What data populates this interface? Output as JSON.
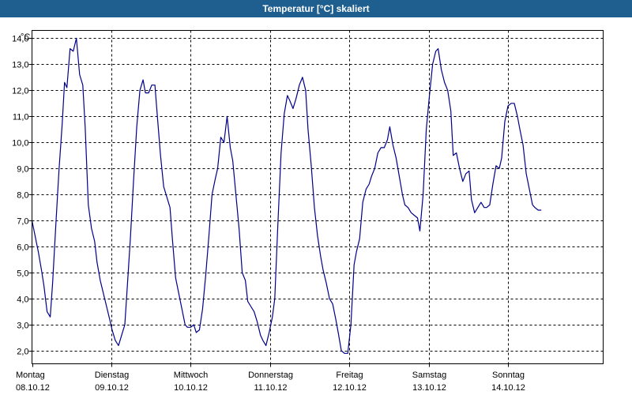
{
  "window": {
    "title": "Temperatur [°C] skaliert"
  },
  "chart_data": {
    "type": "line",
    "title": "Temperatur [°C] skaliert",
    "ylabel": "°C",
    "xlabel": "",
    "ylim": [
      1.5,
      14.3
    ],
    "xlim": [
      0,
      7.2
    ],
    "grid": true,
    "yticks": [
      "2,0",
      "3,0",
      "4,0",
      "5,0",
      "6,0",
      "7,0",
      "8,0",
      "9,0",
      "10,0",
      "11,0",
      "12,0",
      "13,0",
      "14,0"
    ],
    "ytick_values": [
      2,
      3,
      4,
      5,
      6,
      7,
      8,
      9,
      10,
      11,
      12,
      13,
      14
    ],
    "days": [
      {
        "day": "Montag",
        "date": "08.10.12"
      },
      {
        "day": "Dienstag",
        "date": "09.10.12"
      },
      {
        "day": "Mittwoch",
        "date": "10.10.12"
      },
      {
        "day": "Donnerstag",
        "date": "11.10.12"
      },
      {
        "day": "Freitag",
        "date": "12.10.12"
      },
      {
        "day": "Samstag",
        "date": "13.10.12"
      },
      {
        "day": "Sonntag",
        "date": "14.10.12"
      }
    ],
    "line_color": "#00008b",
    "series": [
      {
        "points": [
          [
            0.0,
            7.0
          ],
          [
            0.04,
            6.4
          ],
          [
            0.08,
            5.8
          ],
          [
            0.12,
            5.1
          ],
          [
            0.15,
            4.5
          ],
          [
            0.19,
            3.5
          ],
          [
            0.23,
            3.3
          ],
          [
            0.26,
            4.6
          ],
          [
            0.3,
            6.8
          ],
          [
            0.34,
            8.9
          ],
          [
            0.38,
            10.7
          ],
          [
            0.41,
            12.3
          ],
          [
            0.44,
            12.1
          ],
          [
            0.48,
            13.6
          ],
          [
            0.52,
            13.5
          ],
          [
            0.56,
            14.0
          ],
          [
            0.6,
            12.6
          ],
          [
            0.64,
            12.2
          ],
          [
            0.67,
            10.6
          ],
          [
            0.71,
            7.6
          ],
          [
            0.75,
            6.7
          ],
          [
            0.79,
            6.2
          ],
          [
            0.82,
            5.4
          ],
          [
            0.86,
            4.7
          ],
          [
            0.9,
            4.2
          ],
          [
            0.94,
            3.7
          ],
          [
            0.98,
            3.2
          ],
          [
            1.01,
            2.8
          ],
          [
            1.05,
            2.4
          ],
          [
            1.09,
            2.2
          ],
          [
            1.13,
            2.6
          ],
          [
            1.17,
            3.0
          ],
          [
            1.2,
            4.4
          ],
          [
            1.24,
            6.3
          ],
          [
            1.28,
            8.5
          ],
          [
            1.32,
            10.6
          ],
          [
            1.36,
            12.0
          ],
          [
            1.4,
            12.4
          ],
          [
            1.43,
            11.9
          ],
          [
            1.47,
            11.9
          ],
          [
            1.51,
            12.2
          ],
          [
            1.55,
            12.2
          ],
          [
            1.58,
            11.0
          ],
          [
            1.62,
            9.5
          ],
          [
            1.66,
            8.3
          ],
          [
            1.7,
            7.9
          ],
          [
            1.74,
            7.5
          ],
          [
            1.77,
            6.3
          ],
          [
            1.81,
            4.8
          ],
          [
            1.85,
            4.2
          ],
          [
            1.89,
            3.6
          ],
          [
            1.93,
            3.0
          ],
          [
            1.96,
            2.9
          ],
          [
            2.0,
            2.9
          ],
          [
            2.04,
            3.0
          ],
          [
            2.07,
            2.7
          ],
          [
            2.11,
            2.8
          ],
          [
            2.15,
            3.6
          ],
          [
            2.19,
            4.9
          ],
          [
            2.23,
            6.4
          ],
          [
            2.27,
            8.0
          ],
          [
            2.31,
            8.6
          ],
          [
            2.34,
            9.0
          ],
          [
            2.38,
            10.2
          ],
          [
            2.42,
            10.0
          ],
          [
            2.46,
            11.0
          ],
          [
            2.5,
            9.8
          ],
          [
            2.53,
            9.3
          ],
          [
            2.57,
            8.0
          ],
          [
            2.61,
            6.7
          ],
          [
            2.65,
            5.0
          ],
          [
            2.69,
            4.7
          ],
          [
            2.72,
            3.9
          ],
          [
            2.76,
            3.7
          ],
          [
            2.8,
            3.5
          ],
          [
            2.84,
            3.1
          ],
          [
            2.88,
            2.6
          ],
          [
            2.91,
            2.4
          ],
          [
            2.95,
            2.2
          ],
          [
            2.99,
            2.7
          ],
          [
            3.03,
            3.3
          ],
          [
            3.06,
            4.0
          ],
          [
            3.1,
            6.9
          ],
          [
            3.14,
            9.6
          ],
          [
            3.18,
            11.1
          ],
          [
            3.22,
            11.8
          ],
          [
            3.25,
            11.6
          ],
          [
            3.29,
            11.3
          ],
          [
            3.33,
            11.7
          ],
          [
            3.37,
            12.2
          ],
          [
            3.41,
            12.5
          ],
          [
            3.45,
            12.0
          ],
          [
            3.48,
            10.5
          ],
          [
            3.52,
            9.1
          ],
          [
            3.56,
            7.5
          ],
          [
            3.6,
            6.4
          ],
          [
            3.64,
            5.6
          ],
          [
            3.67,
            5.1
          ],
          [
            3.71,
            4.6
          ],
          [
            3.75,
            4.0
          ],
          [
            3.79,
            3.8
          ],
          [
            3.83,
            3.2
          ],
          [
            3.86,
            2.7
          ],
          [
            3.9,
            2.0
          ],
          [
            3.94,
            1.9
          ],
          [
            3.98,
            1.9
          ],
          [
            4.02,
            3.0
          ],
          [
            4.06,
            5.3
          ],
          [
            4.09,
            5.8
          ],
          [
            4.13,
            6.3
          ],
          [
            4.17,
            7.7
          ],
          [
            4.21,
            8.2
          ],
          [
            4.25,
            8.4
          ],
          [
            4.28,
            8.7
          ],
          [
            4.32,
            9.0
          ],
          [
            4.36,
            9.6
          ],
          [
            4.4,
            9.8
          ],
          [
            4.44,
            9.8
          ],
          [
            4.48,
            10.1
          ],
          [
            4.51,
            10.6
          ],
          [
            4.55,
            9.9
          ],
          [
            4.59,
            9.4
          ],
          [
            4.63,
            8.7
          ],
          [
            4.67,
            8.0
          ],
          [
            4.7,
            7.6
          ],
          [
            4.74,
            7.5
          ],
          [
            4.78,
            7.3
          ],
          [
            4.82,
            7.2
          ],
          [
            4.86,
            7.1
          ],
          [
            4.89,
            6.6
          ],
          [
            4.93,
            8.0
          ],
          [
            4.97,
            10.5
          ],
          [
            5.01,
            11.8
          ],
          [
            5.05,
            13.0
          ],
          [
            5.09,
            13.5
          ],
          [
            5.12,
            13.6
          ],
          [
            5.16,
            12.8
          ],
          [
            5.2,
            12.3
          ],
          [
            5.24,
            12.0
          ],
          [
            5.28,
            11.2
          ],
          [
            5.31,
            9.5
          ],
          [
            5.35,
            9.6
          ],
          [
            5.39,
            9.0
          ],
          [
            5.43,
            8.5
          ],
          [
            5.47,
            8.8
          ],
          [
            5.51,
            8.9
          ],
          [
            5.54,
            7.8
          ],
          [
            5.58,
            7.3
          ],
          [
            5.62,
            7.5
          ],
          [
            5.66,
            7.7
          ],
          [
            5.7,
            7.5
          ],
          [
            5.73,
            7.5
          ],
          [
            5.77,
            7.6
          ],
          [
            5.81,
            8.4
          ],
          [
            5.85,
            9.1
          ],
          [
            5.89,
            9.0
          ],
          [
            5.92,
            9.4
          ],
          [
            5.96,
            10.8
          ],
          [
            6.0,
            11.4
          ],
          [
            6.04,
            11.5
          ],
          [
            6.08,
            11.5
          ],
          [
            6.12,
            11.0
          ],
          [
            6.15,
            10.5
          ],
          [
            6.19,
            9.9
          ],
          [
            6.23,
            8.8
          ],
          [
            6.27,
            8.2
          ],
          [
            6.31,
            7.6
          ],
          [
            6.34,
            7.5
          ],
          [
            6.38,
            7.4
          ],
          [
            6.42,
            7.4
          ]
        ]
      }
    ]
  }
}
